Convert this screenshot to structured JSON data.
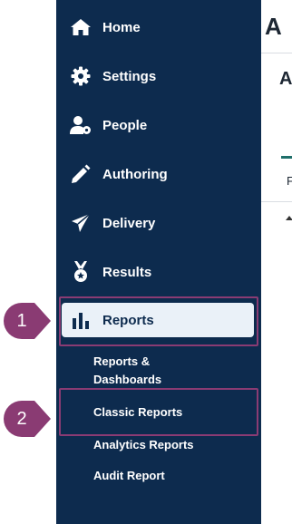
{
  "sidebar": {
    "items": [
      {
        "label": "Home",
        "icon": "home-icon"
      },
      {
        "label": "Settings",
        "icon": "gear-icon"
      },
      {
        "label": "People",
        "icon": "people-icon"
      },
      {
        "label": "Authoring",
        "icon": "pencil-icon"
      },
      {
        "label": "Delivery",
        "icon": "paper-plane-icon"
      },
      {
        "label": "Results",
        "icon": "medal-icon"
      },
      {
        "label": "Reports",
        "icon": "bar-chart-icon",
        "active": true
      }
    ],
    "sub_items": [
      {
        "label": "Reports & Dashboards"
      },
      {
        "label": "Classic Reports"
      },
      {
        "label": "Analytics Reports"
      },
      {
        "label": "Audit Report"
      }
    ]
  },
  "callouts": [
    {
      "number": "1"
    },
    {
      "number": "2"
    }
  ],
  "content": {
    "header_initial": "A",
    "subheader_initial": "A",
    "tab_initial": "F"
  },
  "colors": {
    "sidebar_bg": "#0d2b4e",
    "active_bg": "#eaf1f8",
    "highlight": "#8a3b73",
    "callout": "#8a3b73"
  }
}
